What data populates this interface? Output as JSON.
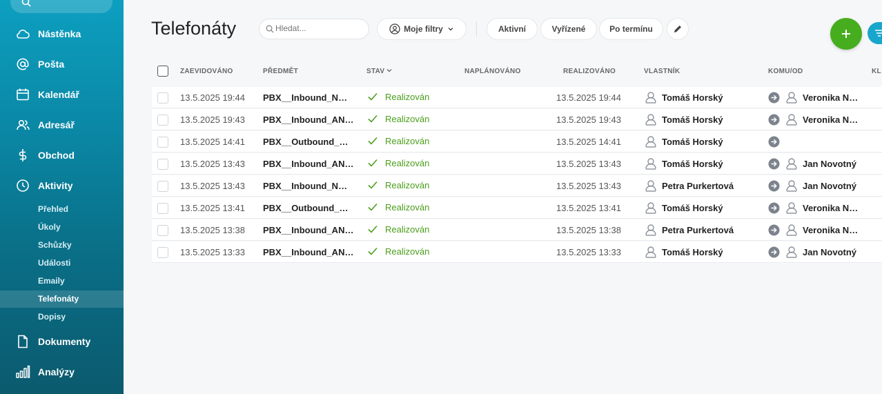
{
  "sidebar": {
    "nav": [
      {
        "label": "Nástěnka",
        "icon": "cloud-icon"
      },
      {
        "label": "Pošta",
        "icon": "at-icon"
      },
      {
        "label": "Kalendář",
        "icon": "calendar-icon"
      },
      {
        "label": "Adresář",
        "icon": "contacts-icon"
      },
      {
        "label": "Obchod",
        "icon": "dollar-icon"
      },
      {
        "label": "Aktivity",
        "icon": "clock-icon"
      }
    ],
    "sub": [
      "Přehled",
      "Úkoly",
      "Schůzky",
      "Události",
      "Emaily",
      "Telefonáty",
      "Dopisy"
    ],
    "active_sub": "Telefonáty",
    "bottom": [
      {
        "label": "Dokumenty",
        "icon": "document-icon"
      },
      {
        "label": "Analýzy",
        "icon": "chart-icon"
      }
    ]
  },
  "header": {
    "title": "Telefonáty",
    "search_placeholder": "Hledat...",
    "my_filters": "Moje filtry",
    "tab_active": "Aktivní",
    "tab_done": "Vyřízené",
    "tab_overdue": "Po termínu"
  },
  "colors": {
    "accent_green": "#46ad1f",
    "accent_blue": "#19a6cd",
    "state_green": "#4a9e1a"
  },
  "table": {
    "columns": {
      "created": "ZAEVIDOVÁNO",
      "subject": "PŘEDMĚT",
      "state": "STAV",
      "planned": "NAPLÁNOVÁNO",
      "realized": "REALIZOVÁNO",
      "owner": "VLASTNÍK",
      "to_from": "KOMU/OD",
      "extra": "KL"
    },
    "rows": [
      {
        "created": "13.5.2025 19:44",
        "subject": "PBX__Inbound_NO A...",
        "state": "Realizován",
        "realized": "13.5.2025 19:44",
        "owner": "Tomáš Horský",
        "to": "Veronika No..."
      },
      {
        "created": "13.5.2025 19:43",
        "subject": "PBX__Inbound_ANS...",
        "state": "Realizován",
        "realized": "13.5.2025 19:43",
        "owner": "Tomáš Horský",
        "to": "Veronika No..."
      },
      {
        "created": "13.5.2025 14:41",
        "subject": "PBX__Outbound_AN...",
        "state": "Realizován",
        "realized": "13.5.2025 14:41",
        "owner": "Tomáš Horský",
        "to": ""
      },
      {
        "created": "13.5.2025 13:43",
        "subject": "PBX__Inbound_ANS...",
        "state": "Realizován",
        "realized": "13.5.2025 13:43",
        "owner": "Tomáš Horský",
        "to": "Jan Novotný"
      },
      {
        "created": "13.5.2025 13:43",
        "subject": "PBX__Inbound_NO A...",
        "state": "Realizován",
        "realized": "13.5.2025 13:43",
        "owner": "Petra Purkertová",
        "to": "Jan Novotný"
      },
      {
        "created": "13.5.2025 13:41",
        "subject": "PBX__Outbound_AN...",
        "state": "Realizován",
        "realized": "13.5.2025 13:41",
        "owner": "Tomáš Horský",
        "to": "Veronika No..."
      },
      {
        "created": "13.5.2025 13:38",
        "subject": "PBX__Inbound_ANS...",
        "state": "Realizován",
        "realized": "13.5.2025 13:38",
        "owner": "Petra Purkertová",
        "to": "Veronika No..."
      },
      {
        "created": "13.5.2025 13:33",
        "subject": "PBX__Inbound_ANS...",
        "state": "Realizován",
        "realized": "13.5.2025 13:33",
        "owner": "Tomáš Horský",
        "to": "Jan Novotný"
      }
    ]
  }
}
